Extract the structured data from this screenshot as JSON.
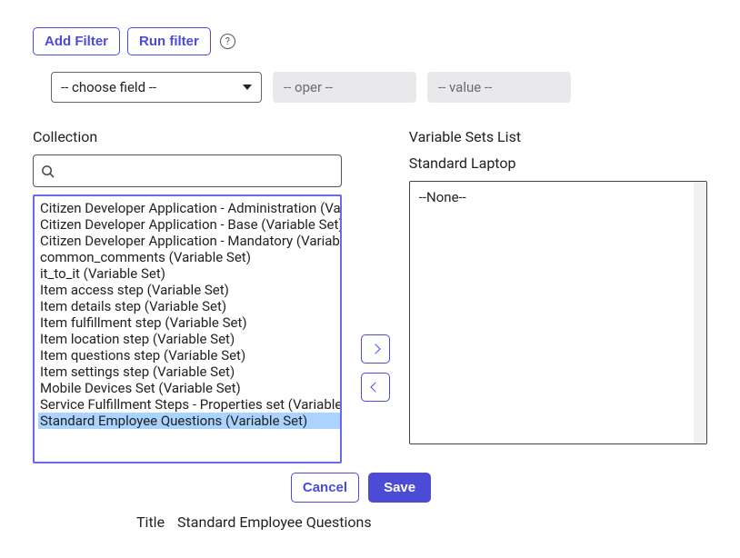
{
  "toolbar": {
    "add_filter": "Add Filter",
    "run_filter": "Run filter"
  },
  "filter": {
    "field_placeholder": "-- choose field --",
    "oper_placeholder": "-- oper --",
    "value_placeholder": "-- value --"
  },
  "left": {
    "label": "Collection",
    "search_value": "",
    "items": [
      "Citizen Developer Application - Administration (Variable Set)",
      "Citizen Developer Application - Base (Variable Set)",
      "Citizen Developer Application - Mandatory (Variable Set)",
      "common_comments (Variable Set)",
      "it_to_it (Variable Set)",
      "Item access step (Variable Set)",
      "Item details step (Variable Set)",
      "Item fulfillment step (Variable Set)",
      "Item location step (Variable Set)",
      "Item questions step (Variable Set)",
      "Item settings step (Variable Set)",
      "Mobile Devices Set (Variable Set)",
      "Service Fulfillment Steps - Properties set (Variable Set)",
      "Standard Employee Questions (Variable Set)"
    ],
    "selected_index": 13
  },
  "right": {
    "label": "Variable Sets List",
    "sublabel": "Standard Laptop",
    "items": [
      "--None--"
    ]
  },
  "footer": {
    "cancel": "Cancel",
    "save": "Save"
  },
  "title_row": {
    "label": "Title",
    "value": "Standard Employee Questions"
  }
}
